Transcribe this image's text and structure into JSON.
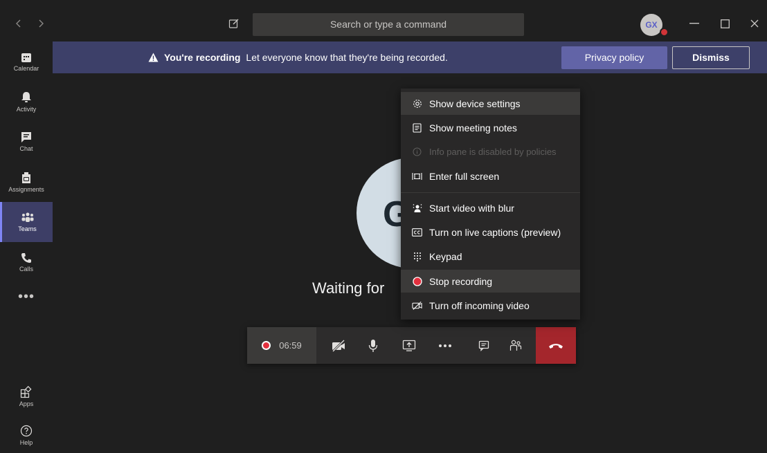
{
  "titlebar": {
    "search_placeholder": "Search or type a command",
    "user_initials": "GX"
  },
  "rail": {
    "items": [
      {
        "label": "Calendar",
        "icon": "calendar-icon"
      },
      {
        "label": "Activity",
        "icon": "bell-icon"
      },
      {
        "label": "Chat",
        "icon": "chat-icon"
      },
      {
        "label": "Assignments",
        "icon": "assignments-icon"
      },
      {
        "label": "Teams",
        "icon": "teams-icon",
        "active": true
      },
      {
        "label": "Calls",
        "icon": "phone-icon"
      }
    ],
    "more": "•••",
    "apps_label": "Apps",
    "help_label": "Help"
  },
  "banner": {
    "title": "You're recording",
    "message": "Let everyone know that they're being recorded.",
    "privacy_label": "Privacy policy",
    "dismiss_label": "Dismiss"
  },
  "stage": {
    "avatar_letter": "G",
    "waiting_text": "Waiting for"
  },
  "controls": {
    "timer": "06:59"
  },
  "menu": {
    "items": [
      {
        "label": "Show device settings",
        "icon": "gear-icon"
      },
      {
        "label": "Show meeting notes",
        "icon": "notes-icon"
      },
      {
        "label": "Info pane is disabled by policies",
        "icon": "info-icon",
        "disabled": true
      },
      {
        "label": "Enter full screen",
        "icon": "fullscreen-icon"
      },
      {
        "label": "Start video with blur",
        "icon": "blur-icon"
      },
      {
        "label": "Turn on live captions (preview)",
        "icon": "captions-icon"
      },
      {
        "label": "Keypad",
        "icon": "keypad-icon"
      },
      {
        "label": "Stop recording",
        "icon": "record-icon"
      },
      {
        "label": "Turn off incoming video",
        "icon": "video-off-icon"
      }
    ]
  },
  "colors": {
    "accent": "#6264a7",
    "banner": "#3d4069",
    "hangup": "#a4262c",
    "recording": "#e3303e"
  }
}
